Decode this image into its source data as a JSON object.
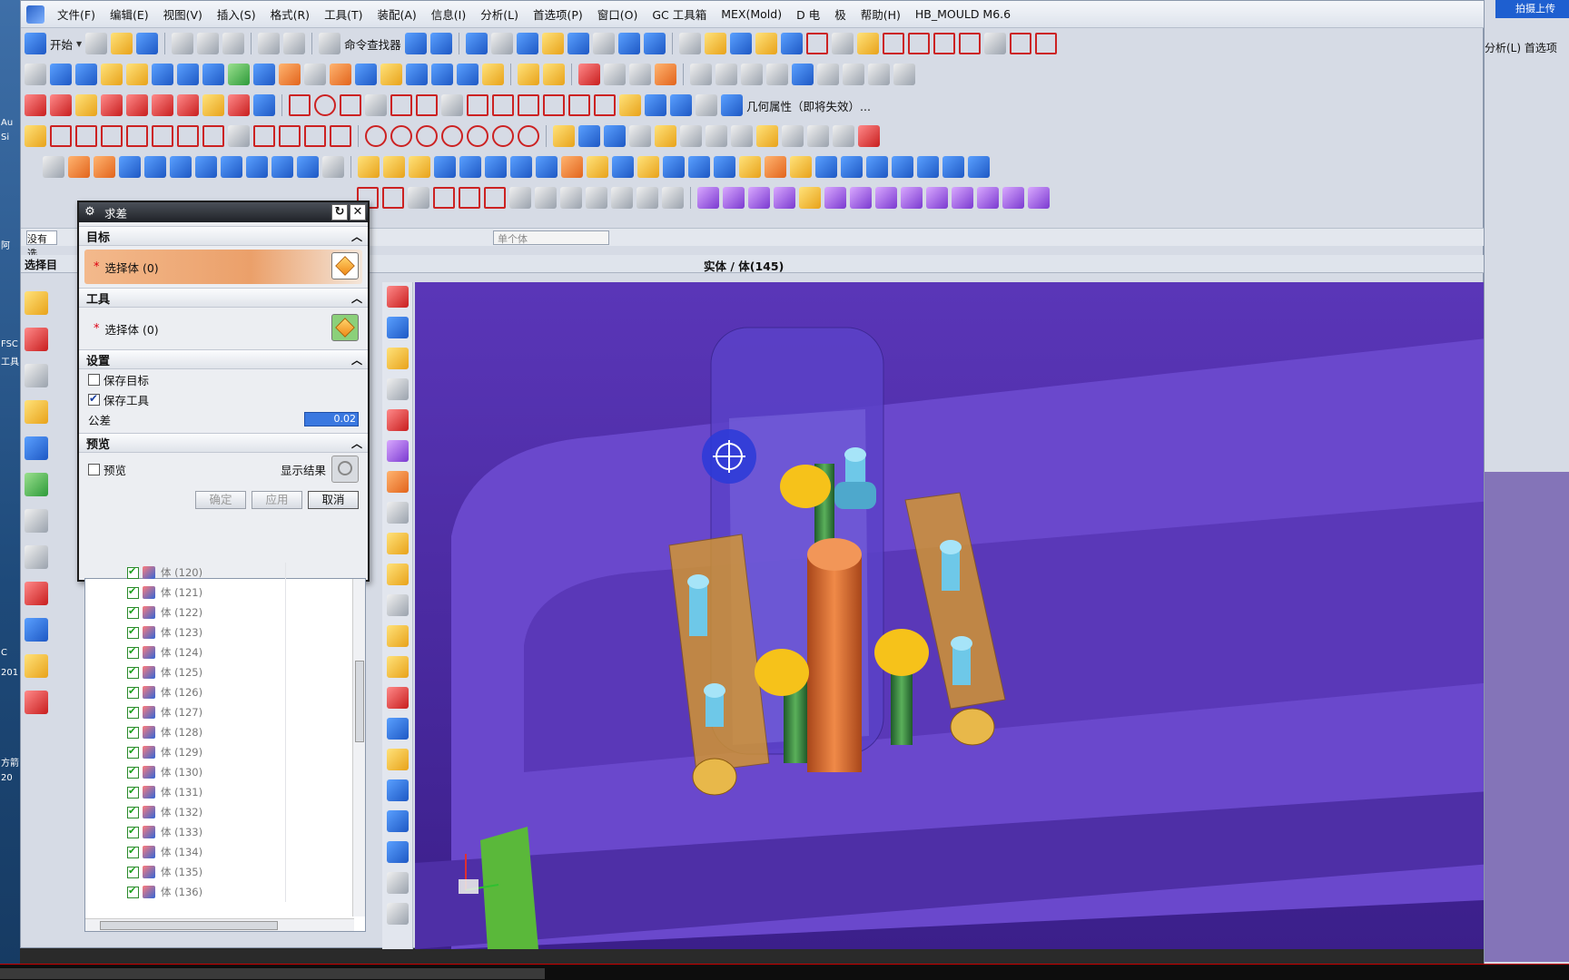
{
  "menu": {
    "items": [
      "文件(F)",
      "编辑(E)",
      "视图(V)",
      "插入(S)",
      "格式(R)",
      "工具(T)",
      "装配(A)",
      "信息(I)",
      "分析(L)",
      "首选项(P)",
      "窗口(O)",
      "GC 工具箱",
      "MEX(Mold)",
      "D 电",
      "极",
      "帮助(H)",
      "HB_MOULD M6.6"
    ]
  },
  "toolbar": {
    "start_label": "开始",
    "command_finder_label": "命令查找器",
    "geometry_props_label": "几何属性（即将失效）..."
  },
  "selection_bar": {
    "filter_value": "没有选",
    "scope_value": "单个体"
  },
  "status": {
    "select_prompt": "选择目",
    "center_text": "实体 / 体(145)"
  },
  "dialog": {
    "title": "求差",
    "target_section": "目标",
    "target_select_label": "选择体 (0)",
    "tool_section": "工具",
    "tool_select_label": "选择体 (0)",
    "settings_section": "设置",
    "keep_target_label": "保存目标",
    "keep_target_checked": false,
    "keep_tool_label": "保存工具",
    "keep_tool_checked": true,
    "tolerance_label": "公差",
    "tolerance_value": "0.02",
    "preview_section": "预览",
    "preview_label": "预览",
    "preview_checked": false,
    "show_result_label": "显示结果",
    "ok_label": "确定",
    "apply_label": "应用",
    "cancel_label": "取消"
  },
  "navigator": {
    "rows": [
      "体 (120)",
      "体 (121)",
      "体 (122)",
      "体 (123)",
      "体 (124)",
      "体 (125)",
      "体 (126)",
      "体 (127)",
      "体 (128)",
      "体 (129)",
      "体 (130)",
      "体 (131)",
      "体 (132)",
      "体 (133)",
      "体 (134)",
      "体 (135)",
      "体 (136)"
    ]
  },
  "rightwindow": {
    "upload_label": "拍摄上传",
    "analysis_label": "分析(L)  首选项"
  },
  "desktop": {
    "labels": [
      "Au",
      "Si",
      "阿",
      "FSC",
      "工具",
      "C",
      "201",
      "方箭",
      "20"
    ]
  },
  "colors": {
    "viewport_bg": "#4a2a9a",
    "plate": "#6c4bd0",
    "ejector_core": "#d66a2a",
    "pin_yellow": "#f6c21a",
    "pin_cyan": "#6ec8e8"
  }
}
